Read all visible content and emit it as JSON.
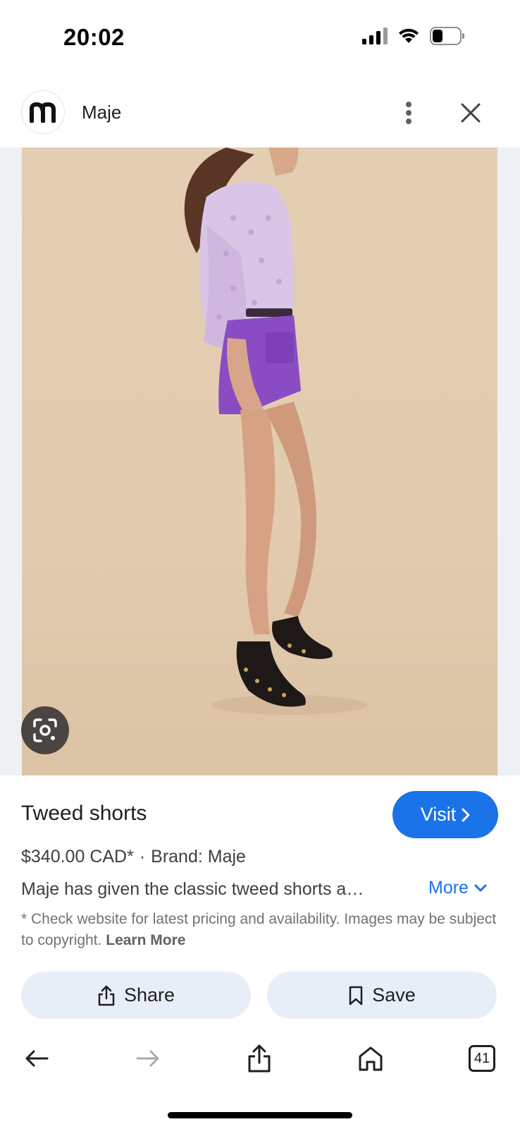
{
  "status_bar": {
    "time": "20:02"
  },
  "header": {
    "source_name": "Maje",
    "avatar_letter": "m",
    "menu_icon": "more-vert-icon",
    "close_icon": "close-icon"
  },
  "product": {
    "title": "Tweed shorts",
    "price": "$340.00 CAD*",
    "separator": "·",
    "brand": "Brand: Maje",
    "description": "Maje has given the classic tweed shorts a…",
    "more_label": "More",
    "disclaimer": "* Check website for latest pricing and availability. Images may be subject to copyright.",
    "learn_more": "Learn More"
  },
  "actions": {
    "visit_label": "Visit",
    "share_label": "Share",
    "save_label": "Save"
  },
  "bottom_nav": {
    "tab_count": "41"
  },
  "colors": {
    "accent": "#1a73e8",
    "button_bg": "#e8eef8",
    "image_bg": "#e2cbaf",
    "shorts": "#8a4cc2"
  }
}
